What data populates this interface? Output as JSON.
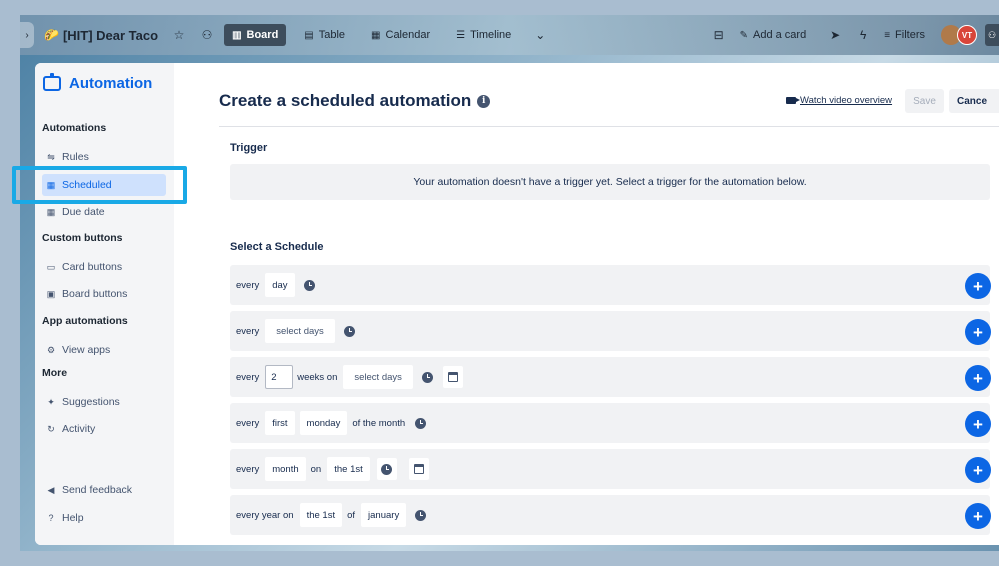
{
  "topbar": {
    "board_emoji": "🌮",
    "board_title": "[HIT] Dear Taco",
    "views": [
      {
        "label": "Board",
        "icon": "board-icon",
        "active": true
      },
      {
        "label": "Table",
        "icon": "table-icon",
        "active": false
      },
      {
        "label": "Calendar",
        "icon": "calendar-icon",
        "active": false
      },
      {
        "label": "Timeline",
        "icon": "timeline-icon",
        "active": false
      }
    ],
    "add_card_label": "Add a card",
    "filters_label": "Filters",
    "avatar_initials": "VT"
  },
  "sidebar": {
    "title": "Automation",
    "sections": [
      {
        "title": "Automations",
        "items": [
          {
            "label": "Rules",
            "icon": "sliders-icon"
          },
          {
            "label": "Scheduled",
            "icon": "calendar-icon",
            "selected": true
          },
          {
            "label": "Due date",
            "icon": "calendar-icon"
          }
        ]
      },
      {
        "title": "Custom buttons",
        "items": [
          {
            "label": "Card buttons",
            "icon": "card-icon"
          },
          {
            "label": "Board buttons",
            "icon": "board-icon"
          }
        ]
      },
      {
        "title": "App automations",
        "items": [
          {
            "label": "View apps",
            "icon": "gear-icon"
          }
        ]
      },
      {
        "title": "More",
        "items": [
          {
            "label": "Suggestions",
            "icon": "sparkle-icon"
          },
          {
            "label": "Activity",
            "icon": "refresh-icon"
          }
        ]
      }
    ],
    "footer": [
      {
        "label": "Send feedback",
        "icon": "megaphone-icon"
      },
      {
        "label": "Help",
        "icon": "help-icon"
      }
    ]
  },
  "main": {
    "title": "Create a scheduled automation",
    "watch_label": "Watch video overview",
    "save_label": "Save",
    "cancel_label": "Cance",
    "trigger_heading": "Trigger",
    "trigger_message": "Your automation doesn't have a trigger yet. Select a trigger for the automation below.",
    "schedule_heading": "Select a Schedule",
    "rows": [
      {
        "words": [
          "every"
        ],
        "chips": [
          "day"
        ]
      },
      {
        "words": [
          "every"
        ],
        "chips": [
          "select days"
        ]
      },
      {
        "every": "every",
        "num": "2",
        "weeks_on": "weeks on",
        "chip": "select days"
      },
      {
        "every": "every",
        "first": "first",
        "day": "monday",
        "suffix": "of the month"
      },
      {
        "every": "every",
        "unit": "month",
        "on": "on",
        "date": "the 1st"
      },
      {
        "every": "every year on",
        "date": "the 1st",
        "of": "of",
        "month": "january"
      }
    ]
  }
}
